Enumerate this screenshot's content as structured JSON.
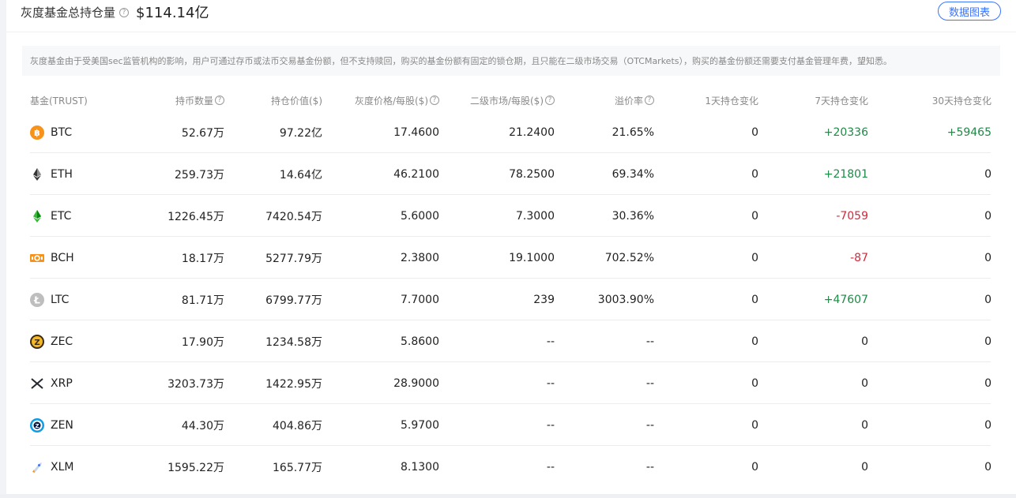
{
  "header": {
    "title": "灰度基金总持仓量",
    "total_value": "$114.14亿",
    "data_chart_button": "数据图表"
  },
  "notice": "灰度基金由于受美国sec监管机构的影响，用户可通过存币或法币交易基金份额，但不支持赎回，购买的基金份额有固定的锁仓期，且只能在二级市场交易（OTCMarkets），购买的基金份额还需要支付基金管理年费，望知悉。",
  "columns": {
    "fund": "基金(TRUST)",
    "holdings": "持币数量",
    "value": "持仓价值($)",
    "gs_price": "灰度价格/每股($)",
    "secondary_price": "二级市场/每股($)",
    "premium": "溢价率",
    "change_1d": "1天持仓变化",
    "change_7d": "7天持仓变化",
    "change_30d": "30天持仓变化"
  },
  "rows": [
    {
      "coin": "BTC",
      "holdings": "52.67万",
      "value": "97.22亿",
      "gs_price": "17.4600",
      "secondary_price": "21.2400",
      "premium": "21.65%",
      "change_1d": "0",
      "change_7d": "+20336",
      "change_30d": "+59465",
      "c7": "pos",
      "c30": "pos"
    },
    {
      "coin": "ETH",
      "holdings": "259.73万",
      "value": "14.64亿",
      "gs_price": "46.2100",
      "secondary_price": "78.2500",
      "premium": "69.34%",
      "change_1d": "0",
      "change_7d": "+21801",
      "change_30d": "0",
      "c7": "pos",
      "c30": ""
    },
    {
      "coin": "ETC",
      "holdings": "1226.45万",
      "value": "7420.54万",
      "gs_price": "5.6000",
      "secondary_price": "7.3000",
      "premium": "30.36%",
      "change_1d": "0",
      "change_7d": "-7059",
      "change_30d": "0",
      "c7": "neg",
      "c30": ""
    },
    {
      "coin": "BCH",
      "holdings": "18.17万",
      "value": "5277.79万",
      "gs_price": "2.3800",
      "secondary_price": "19.1000",
      "premium": "702.52%",
      "change_1d": "0",
      "change_7d": "-87",
      "change_30d": "0",
      "c7": "neg",
      "c30": ""
    },
    {
      "coin": "LTC",
      "holdings": "81.71万",
      "value": "6799.77万",
      "gs_price": "7.7000",
      "secondary_price": "239",
      "premium": "3003.90%",
      "change_1d": "0",
      "change_7d": "+47607",
      "change_30d": "0",
      "c7": "pos",
      "c30": ""
    },
    {
      "coin": "ZEC",
      "holdings": "17.90万",
      "value": "1234.58万",
      "gs_price": "5.8600",
      "secondary_price": "--",
      "premium": "--",
      "change_1d": "0",
      "change_7d": "0",
      "change_30d": "0",
      "c7": "",
      "c30": ""
    },
    {
      "coin": "XRP",
      "holdings": "3203.73万",
      "value": "1422.95万",
      "gs_price": "28.9000",
      "secondary_price": "--",
      "premium": "--",
      "change_1d": "0",
      "change_7d": "0",
      "change_30d": "0",
      "c7": "",
      "c30": ""
    },
    {
      "coin": "ZEN",
      "holdings": "44.30万",
      "value": "404.86万",
      "gs_price": "5.9700",
      "secondary_price": "--",
      "premium": "--",
      "change_1d": "0",
      "change_7d": "0",
      "change_30d": "0",
      "c7": "",
      "c30": ""
    },
    {
      "coin": "XLM",
      "holdings": "1595.22万",
      "value": "165.77万",
      "gs_price": "8.1300",
      "secondary_price": "--",
      "premium": "--",
      "change_1d": "0",
      "change_7d": "0",
      "change_30d": "0",
      "c7": "",
      "c30": ""
    }
  ],
  "icons": {
    "BTC": "btc-icon",
    "ETH": "eth-icon",
    "ETC": "etc-icon",
    "BCH": "bch-icon",
    "LTC": "ltc-icon",
    "ZEC": "zec-icon",
    "XRP": "xrp-icon",
    "ZEN": "zen-icon",
    "XLM": "xlm-icon"
  },
  "colors": {
    "accent": "#3b73ff",
    "positive": "#1e8a46",
    "negative": "#d9263a"
  }
}
